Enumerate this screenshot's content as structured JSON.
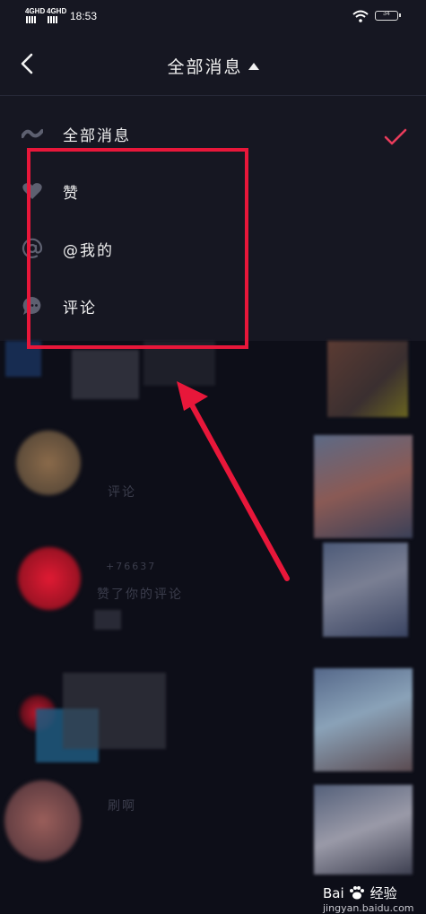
{
  "status_bar": {
    "signal_1": "4GHD",
    "signal_2": "4GHD",
    "time": "18:53",
    "battery_level": "34",
    "wifi_icon": "wifi-icon",
    "battery_icon": "battery-icon"
  },
  "header": {
    "back_icon": "chevron-left-icon",
    "title": "全部消息",
    "dropdown_icon": "caret-up-icon"
  },
  "menu": {
    "items": [
      {
        "label": "全部消息",
        "icon": "wave-icon",
        "selected": true
      },
      {
        "label": "赞",
        "icon": "heart-icon",
        "selected": false
      },
      {
        "label": "@我的",
        "icon": "at-icon",
        "selected": false
      },
      {
        "label": "评论",
        "icon": "comment-icon",
        "selected": false
      }
    ],
    "check_icon": "check-icon"
  },
  "background_feed": {
    "blurred_texts": [
      "评论",
      "+76637",
      "赞了你的评论",
      "刷啊"
    ]
  },
  "annotation": {
    "box_color": "#e8173a",
    "arrow_color": "#e8173a"
  },
  "watermark": {
    "brand": "Bai",
    "brand_suffix": "经验",
    "url": "jingyan.baidu.com"
  },
  "colors": {
    "accent": "#e83c5b",
    "panel": "#161722",
    "background": "#0c0d16"
  }
}
